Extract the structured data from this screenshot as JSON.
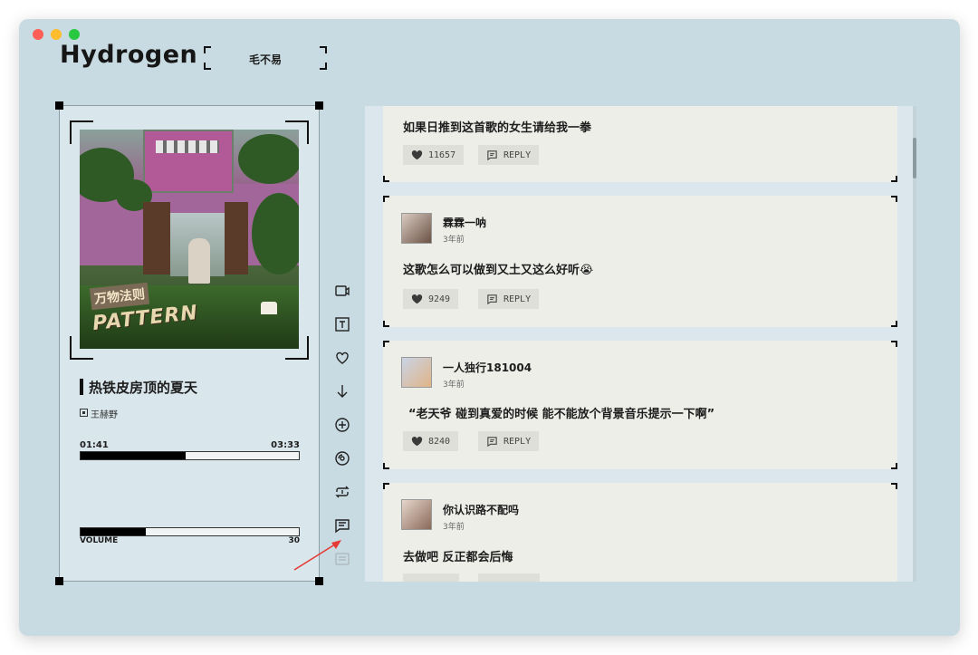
{
  "app": {
    "title": "Hydrogen"
  },
  "search": {
    "value": "毛不易"
  },
  "player": {
    "song_title": "热铁皮房顶的夏天",
    "artist": "王赫野",
    "album_art": {
      "title_cn": "万物法则",
      "title_en": "PATTERN"
    },
    "time_current": "01:41",
    "time_total": "03:33",
    "progress": 0.48,
    "volume_label": "VOLUME",
    "volume_value": "30",
    "volume_level": 0.3
  },
  "toolbar": {
    "icons": [
      "mv-icon",
      "lyrics-icon",
      "heart-icon",
      "download-icon",
      "add-icon",
      "album-icon",
      "repeat-one-icon",
      "comments-icon",
      "queue-icon"
    ]
  },
  "comments": [
    {
      "user": "",
      "time": "",
      "text": "如果日推到这首歌的女生请给我一拳",
      "likes": "11657",
      "reply": "REPLY"
    },
    {
      "user": "霖霖一呐",
      "time": "3年前",
      "text": "这歌怎么可以做到又土又这么好听😭",
      "likes": "9249",
      "reply": "REPLY"
    },
    {
      "user": "一人独行181004",
      "time": "3年前",
      "text": "“老天爷 碰到真爱的时候 能不能放个背景音乐提示一下啊”",
      "likes": "8240",
      "reply": "REPLY"
    },
    {
      "user": "你认识路不配吗",
      "time": "3年前",
      "text": "去做吧 反正都会后悔",
      "likes": "",
      "reply": ""
    }
  ],
  "colors": {
    "window_bg": "#c9dbe2",
    "card_bg": "#eeeee9",
    "chip_bg": "#dfdfd9",
    "arrow": "#e53935"
  }
}
